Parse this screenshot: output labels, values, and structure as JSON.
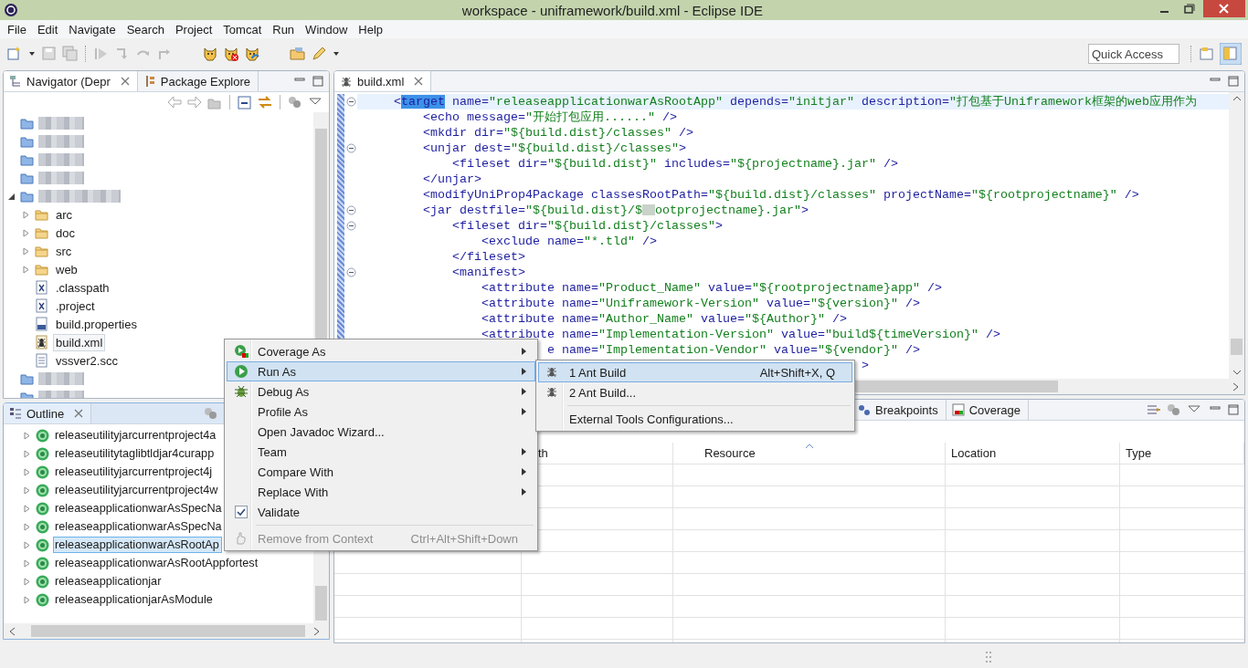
{
  "window": {
    "title": "workspace - uniframework/build.xml - Eclipse IDE"
  },
  "menu_bar": [
    "File",
    "Edit",
    "Navigate",
    "Search",
    "Project",
    "Tomcat",
    "Run",
    "Window",
    "Help"
  ],
  "quick_access": {
    "placeholder": "Quick Access"
  },
  "navigator": {
    "tabs": [
      {
        "label": "Navigator (Depr",
        "selected": true
      },
      {
        "label": "Package Explore",
        "selected": false
      }
    ],
    "tree": [
      {
        "kind": "blurred",
        "selected": false
      },
      {
        "kind": "blurred",
        "selected": false
      },
      {
        "kind": "blurred",
        "selected": false
      },
      {
        "kind": "blurred",
        "selected": false
      },
      {
        "kind": "blurred",
        "selected": false,
        "expanded": true,
        "children": [
          {
            "kind": "folder",
            "label": "arc",
            "expanded": false,
            "selected": false
          },
          {
            "kind": "folder",
            "label": "doc",
            "expanded": false,
            "selected": false
          },
          {
            "kind": "folder",
            "label": "src",
            "expanded": false,
            "selected": false
          },
          {
            "kind": "folder",
            "label": "web",
            "expanded": false,
            "selected": false
          },
          {
            "kind": "xml",
            "label": ".classpath",
            "selected": false
          },
          {
            "kind": "xml",
            "label": ".project",
            "selected": false
          },
          {
            "kind": "properties",
            "label": "build.properties",
            "selected": false
          },
          {
            "kind": "ant",
            "label": "build.xml",
            "selected": true
          },
          {
            "kind": "text",
            "label": "vssver2.scc",
            "selected": false
          }
        ]
      },
      {
        "kind": "blurred",
        "selected": false
      },
      {
        "kind": "blurred",
        "selected": false
      }
    ]
  },
  "outline": {
    "tab": "Outline",
    "items": [
      {
        "label": "releaseutilityjarcurrentproject4a",
        "selected": false
      },
      {
        "label": "releaseutilitytaglibtldjar4curapp",
        "selected": false
      },
      {
        "label": "releaseutilityjarcurrentproject4j",
        "selected": false
      },
      {
        "label": "releaseutilityjarcurrentproject4w",
        "selected": false
      },
      {
        "label": "releaseapplicationwarAsSpecNa",
        "selected": false
      },
      {
        "label": "releaseapplicationwarAsSpecNa",
        "selected": false
      },
      {
        "label": "releaseapplicationwarAsRootAp",
        "selected": true
      },
      {
        "label": "releaseapplicationwarAsRootAppfortest",
        "selected": false
      },
      {
        "label": "releaseapplicationjar",
        "selected": false
      },
      {
        "label": "releaseapplicationjarAsModule",
        "selected": false
      }
    ]
  },
  "editor": {
    "tab": "build.xml",
    "lines": [
      {
        "fold": true,
        "current": true,
        "parts": [
          {
            "kind": "markup",
            "text": "    <"
          },
          {
            "kind": "selection",
            "text": "target"
          },
          {
            "kind": "markup",
            "text": " name="
          },
          {
            "kind": "value",
            "text": "\"releaseapplicationwarAsRootApp\""
          },
          {
            "kind": "markup",
            "text": " depends="
          },
          {
            "kind": "value",
            "text": "\"initjar\""
          },
          {
            "kind": "markup",
            "text": " description="
          },
          {
            "kind": "value",
            "text": "\"打包基于Uniframework框架的web应用作为"
          }
        ]
      },
      {
        "fold": false,
        "current": false,
        "parts": [
          {
            "kind": "markup",
            "text": "        <echo message="
          },
          {
            "kind": "value",
            "text": "\"开始打包应用......\""
          },
          {
            "kind": "markup",
            "text": " />"
          }
        ]
      },
      {
        "fold": false,
        "current": false,
        "parts": [
          {
            "kind": "markup",
            "text": "        <mkdir dir="
          },
          {
            "kind": "value",
            "text": "\"${build.dist}/classes\""
          },
          {
            "kind": "markup",
            "text": " />"
          }
        ]
      },
      {
        "fold": true,
        "current": false,
        "parts": [
          {
            "kind": "markup",
            "text": "        <unjar dest="
          },
          {
            "kind": "value",
            "text": "\"${build.dist}/classes\""
          },
          {
            "kind": "markup",
            "text": ">"
          }
        ]
      },
      {
        "fold": false,
        "current": false,
        "parts": [
          {
            "kind": "markup",
            "text": "            <fileset dir="
          },
          {
            "kind": "value",
            "text": "\"${build.dist}\""
          },
          {
            "kind": "markup",
            "text": " includes="
          },
          {
            "kind": "value",
            "text": "\"${projectname}.jar\""
          },
          {
            "kind": "markup",
            "text": " />"
          }
        ]
      },
      {
        "fold": false,
        "current": false,
        "parts": [
          {
            "kind": "markup",
            "text": "        </unjar>"
          }
        ]
      },
      {
        "fold": false,
        "current": false,
        "parts": [
          {
            "kind": "markup",
            "text": "        <modifyUniProp4Package classesRootPath="
          },
          {
            "kind": "value",
            "text": "\"${build.dist}/classes\""
          },
          {
            "kind": "markup",
            "text": " projectName="
          },
          {
            "kind": "value",
            "text": "\"${rootprojectname}\""
          },
          {
            "kind": "markup",
            "text": " />"
          }
        ]
      },
      {
        "fold": true,
        "current": false,
        "parts": [
          {
            "kind": "markup",
            "text": "        <jar destfile="
          },
          {
            "kind": "value",
            "text": "\"${build.dist}/$"
          },
          {
            "kind": "blur"
          },
          {
            "kind": "value",
            "text": "ootprojectname}.jar\""
          },
          {
            "kind": "markup",
            "text": ">"
          }
        ]
      },
      {
        "fold": true,
        "current": false,
        "parts": [
          {
            "kind": "markup",
            "text": "            <fileset dir="
          },
          {
            "kind": "value",
            "text": "\"${build.dist}/classes\""
          },
          {
            "kind": "markup",
            "text": ">"
          }
        ]
      },
      {
        "fold": false,
        "current": false,
        "parts": [
          {
            "kind": "markup",
            "text": "                <exclude name="
          },
          {
            "kind": "value",
            "text": "\"*.tld\""
          },
          {
            "kind": "markup",
            "text": " />"
          }
        ]
      },
      {
        "fold": false,
        "current": false,
        "parts": [
          {
            "kind": "markup",
            "text": "            </fileset>"
          }
        ]
      },
      {
        "fold": true,
        "current": false,
        "parts": [
          {
            "kind": "markup",
            "text": "            <manifest>"
          }
        ]
      },
      {
        "fold": false,
        "current": false,
        "parts": [
          {
            "kind": "markup",
            "text": "                <attribute name="
          },
          {
            "kind": "value",
            "text": "\"Product_Name\""
          },
          {
            "kind": "markup",
            "text": " value="
          },
          {
            "kind": "value",
            "text": "\"${rootprojectname}app\""
          },
          {
            "kind": "markup",
            "text": " />"
          }
        ]
      },
      {
        "fold": false,
        "current": false,
        "parts": [
          {
            "kind": "markup",
            "text": "                <attribute name="
          },
          {
            "kind": "value",
            "text": "\"Uniframework-Version\""
          },
          {
            "kind": "markup",
            "text": " value="
          },
          {
            "kind": "value",
            "text": "\"${version}\""
          },
          {
            "kind": "markup",
            "text": " />"
          }
        ]
      },
      {
        "fold": false,
        "current": false,
        "parts": [
          {
            "kind": "markup",
            "text": "                <attribute name="
          },
          {
            "kind": "value",
            "text": "\"Author_Name\""
          },
          {
            "kind": "markup",
            "text": " value="
          },
          {
            "kind": "value",
            "text": "\"${Author}\""
          },
          {
            "kind": "markup",
            "text": " />"
          }
        ]
      },
      {
        "fold": false,
        "current": false,
        "parts": [
          {
            "kind": "markup",
            "text": "                <attribute name="
          },
          {
            "kind": "value",
            "text": "\"Implementation-Version\""
          },
          {
            "kind": "markup",
            "text": " value="
          },
          {
            "kind": "value",
            "text": "\"build${timeVersion}\""
          },
          {
            "kind": "markup",
            "text": " />"
          }
        ]
      },
      {
        "fold": false,
        "current": false,
        "parts": [
          {
            "kind": "markup",
            "text": "                         e name="
          },
          {
            "kind": "value",
            "text": "\"Implementation-Vendor\""
          },
          {
            "kind": "markup",
            "text": " value="
          },
          {
            "kind": "value",
            "text": "\"${vendor}\""
          },
          {
            "kind": "markup",
            "text": " />"
          }
        ]
      },
      {
        "fold": false,
        "current": false,
        "parts": [
          {
            "kind": "markup",
            "text": "                                                                    >"
          }
        ]
      }
    ]
  },
  "bottom_panel": {
    "tabs": [
      {
        "label": "Breakpoints",
        "selected": false
      },
      {
        "label": "Coverage",
        "selected": false
      }
    ],
    "columns": [
      {
        "label": "th",
        "sorted": false
      },
      {
        "label": "Resource",
        "sorted": true
      },
      {
        "label": "Location",
        "sorted": false
      },
      {
        "label": "Type",
        "sorted": false
      }
    ]
  },
  "context_menu": {
    "items": [
      {
        "kind": "coverage",
        "label": "Coverage As",
        "submenu": true,
        "selected": false
      },
      {
        "kind": "run",
        "label": "Run As",
        "submenu": true,
        "selected": true
      },
      {
        "kind": "debug",
        "label": "Debug As",
        "submenu": true,
        "selected": false
      },
      {
        "kind": "plain",
        "label": "Profile As",
        "submenu": true,
        "selected": false
      },
      {
        "kind": "plain",
        "label": "Open Javadoc Wizard...",
        "submenu": false,
        "selected": false
      },
      {
        "kind": "plain",
        "label": "Team",
        "submenu": true,
        "selected": false
      },
      {
        "kind": "plain",
        "label": "Compare With",
        "submenu": true,
        "selected": false
      },
      {
        "kind": "plain",
        "label": "Replace With",
        "submenu": true,
        "selected": false
      },
      {
        "kind": "check",
        "label": "Validate",
        "submenu": false,
        "selected": false,
        "checked": true
      },
      {
        "kind": "separator"
      },
      {
        "kind": "context",
        "label": "Remove from Context",
        "shortcut": "Ctrl+Alt+Shift+Down",
        "submenu": false,
        "selected": false,
        "disabled": true
      }
    ]
  },
  "submenu": {
    "items": [
      {
        "kind": "ant",
        "label": "1 Ant Build",
        "shortcut": "Alt+Shift+X, Q",
        "selected": true
      },
      {
        "kind": "ant",
        "label": "2 Ant Build...",
        "selected": false
      },
      {
        "kind": "separator"
      },
      {
        "kind": "plain",
        "label": "External Tools Configurations...",
        "selected": false
      }
    ]
  }
}
